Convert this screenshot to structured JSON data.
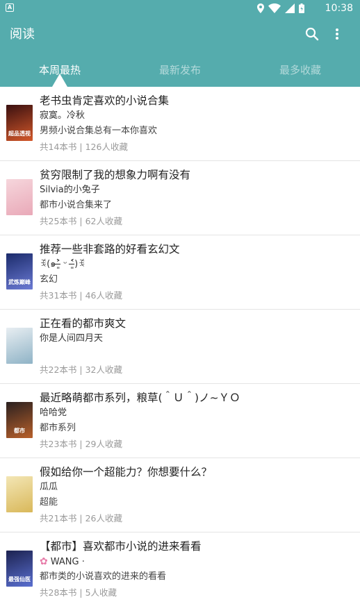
{
  "statusbar": {
    "time": "10:38",
    "notification_icon": "A"
  },
  "appbar": {
    "title": "阅读",
    "search_icon": "search-icon",
    "more_icon": "more-vert-icon",
    "color": "#55acad"
  },
  "tabs": [
    {
      "label": "本周最热",
      "active": true
    },
    {
      "label": "最新发布",
      "active": false
    },
    {
      "label": "最多收藏",
      "active": false
    }
  ],
  "items": [
    {
      "title": "老书虫肯定喜欢的小说合集",
      "author": "寂寞。冷秋",
      "desc": "男频小说合集总有一本你喜欢",
      "books": "共14本书",
      "sep": "|",
      "favs": "126人收藏",
      "cover_text": "超品透视",
      "cover_colors": [
        "#3a1010",
        "#d4582a"
      ]
    },
    {
      "title": "贫穷限制了我的想象力啊有没有",
      "author": "Silvia的小兔子",
      "desc": "都市小说合集来了",
      "books": "共25本书",
      "sep": "|",
      "favs": "62人收藏",
      "cover_text": "",
      "cover_colors": [
        "#f6d6dc",
        "#e9a9b8"
      ]
    },
    {
      "title": "推荐一些非套路的好看玄幻文",
      "author": "ꉂ(๑˃̶͈̀ ᵕ ˂̶͈́)ꉂ",
      "desc": "玄幻",
      "books": "共31本书",
      "sep": "|",
      "favs": "46人收藏",
      "cover_text": "武炼巅峰",
      "cover_colors": [
        "#1b2b6b",
        "#6b7ad4"
      ]
    },
    {
      "title": "正在看的都市爽文",
      "author": "你是人间四月天",
      "desc": "",
      "books": "共22本书",
      "sep": "|",
      "favs": "32人收藏",
      "cover_text": "",
      "cover_colors": [
        "#e8eef2",
        "#8fb3c6"
      ]
    },
    {
      "title": "最近略萌都市系列，粮草(＾Ｕ＾)ノ~ＹＯ",
      "author": "哈哈党",
      "desc": "都市系列",
      "books": "共23本书",
      "sep": "|",
      "favs": "29人收藏",
      "cover_text": "都市",
      "cover_colors": [
        "#2a2020",
        "#b8602a"
      ]
    },
    {
      "title": "假如给你一个超能力？你想要什么？",
      "author": "瓜瓜",
      "desc": "超能",
      "books": "共21本书",
      "sep": "|",
      "favs": "26人收藏",
      "cover_text": "",
      "cover_colors": [
        "#f3e6b5",
        "#d9b85a"
      ]
    },
    {
      "title": "【都市】喜欢都市小说的进来看看",
      "author": "WANG ·",
      "desc": "都市类的小说喜欢的进来的看看",
      "books": "共28本书",
      "sep": "|",
      "favs": "5人收藏",
      "cover_text": "最强仙医",
      "cover_colors": [
        "#1c2250",
        "#5a6fd0"
      ]
    }
  ]
}
